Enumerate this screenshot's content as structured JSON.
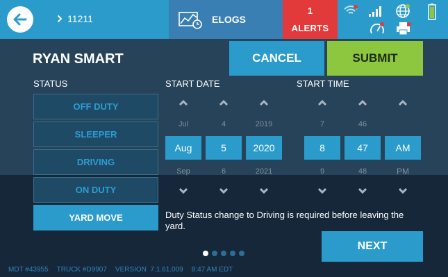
{
  "topbar": {
    "breadcrumb": "11211",
    "elogs_label": "ELOGS",
    "alerts_count": "1",
    "alerts_label": "ALERTS",
    "icons": [
      "back-arrow-icon",
      "chevron-right-icon",
      "elogs-chart-icon",
      "wifi-icon",
      "signal-icon",
      "globe-icon",
      "battery-icon",
      "speed-gauge-icon",
      "printer-icon"
    ],
    "colors": {
      "bar": "#2a9bcb",
      "elogs": "#3a7fb4",
      "alerts": "#e23a3a"
    }
  },
  "header": {
    "driver_name": "RYAN SMART",
    "cancel_label": "CANCEL",
    "submit_label": "SUBMIT",
    "submit_color": "#8dc63f"
  },
  "labels": {
    "status": "STATUS",
    "start_date": "START DATE",
    "start_time": "START TIME"
  },
  "statuses": [
    {
      "label": "OFF DUTY",
      "selected": false
    },
    {
      "label": "SLEEPER",
      "selected": false
    },
    {
      "label": "DRIVING",
      "selected": false
    },
    {
      "label": "ON DUTY",
      "selected": false
    },
    {
      "label": "YARD MOVE",
      "selected": true
    }
  ],
  "date_picker": {
    "month": {
      "prev": "Jul",
      "value": "Aug",
      "next": "Sep"
    },
    "day": {
      "prev": "4",
      "value": "5",
      "next": "6"
    },
    "year": {
      "prev": "2019",
      "value": "2020",
      "next": "2021"
    }
  },
  "time_picker": {
    "hour": {
      "prev": "7",
      "value": "8",
      "next": "9"
    },
    "minute": {
      "prev": "46",
      "value": "47",
      "next": "48"
    },
    "ampm": {
      "prev": "",
      "value": "AM",
      "next": "PM"
    }
  },
  "notice": "Duty Status change to Driving is required before leaving the yard.",
  "pagination": {
    "current": 1,
    "total": 5
  },
  "next_label": "NEXT",
  "footer": {
    "mdt": "MDT #43955",
    "truck": "TRUCK #D9907",
    "version": "VERSION  7.1.61.009",
    "time": "8:47 AM EDT"
  }
}
